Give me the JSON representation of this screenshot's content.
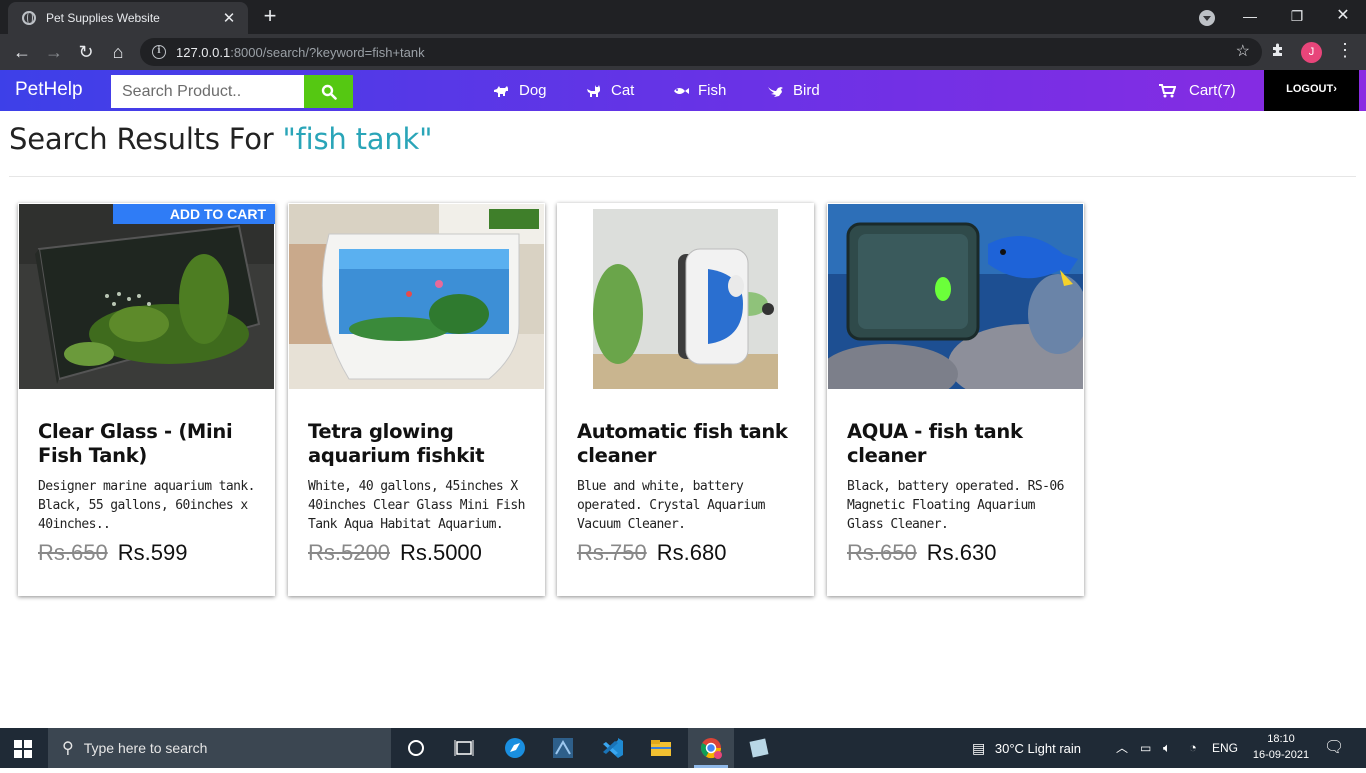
{
  "browser": {
    "tab_title": "Pet Supplies Website",
    "url_host": "127.0.0.1",
    "url_rest": ":8000/search/?keyword=fish+tank",
    "profile_initial": "J"
  },
  "site": {
    "brand": "PetHelp",
    "search_placeholder": "Search Product..",
    "nav": [
      "Dog",
      "Cat",
      "Fish",
      "Bird"
    ],
    "cart_label": "Cart(7)",
    "logout_label": "LOGOUT"
  },
  "results": {
    "heading_prefix": "Search Results For ",
    "keyword": "\"fish tank\"",
    "add_to_cart_label": "ADD TO CART",
    "products": [
      {
        "title": "Clear Glass - (Mini Fish Tank)",
        "description": "Designer marine aquarium tank. Black, 55 gallons, 60inches x 40inches..",
        "old_price": "Rs.650",
        "price": "Rs.599"
      },
      {
        "title": "Tetra glowing aquarium fishkit",
        "description": "White, 40 gallons, 45inches X 40inches Clear Glass Mini Fish Tank Aqua Habitat Aquarium.",
        "old_price": "Rs.5200",
        "price": "Rs.5000"
      },
      {
        "title": "Automatic fish tank cleaner",
        "description": "Blue and white, battery operated. Crystal Aquarium Vacuum Cleaner.",
        "old_price": "Rs.750",
        "price": "Rs.680"
      },
      {
        "title": "AQUA - fish tank cleaner",
        "description": "Black, battery operated. RS-06 Magnetic Floating Aquarium Glass Cleaner.",
        "old_price": "Rs.650",
        "price": "Rs.630"
      }
    ]
  },
  "taskbar": {
    "search_placeholder": "Type here to search",
    "weather": "30°C  Light rain",
    "language": "ENG",
    "time": "18:10",
    "date": "16-09-2021"
  }
}
